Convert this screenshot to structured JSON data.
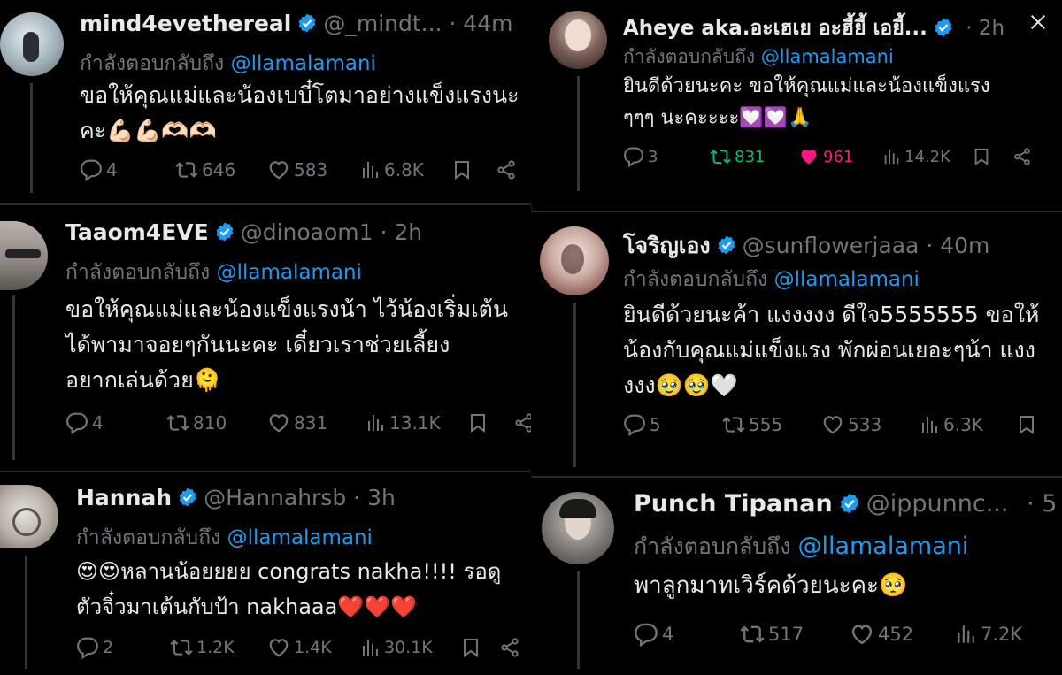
{
  "reply_prefix": "กำลังตอบกลับถึง",
  "colors": {
    "accent": "#1d9bf0",
    "muted": "#71767b",
    "text": "#e7e9ea",
    "like_active": "#f91880",
    "repost_active": "#00ba7c"
  },
  "tweets": [
    {
      "name": "mind4evethereal",
      "handle": "@_mindt...",
      "sep": "·",
      "time": "44m",
      "mention": "@llamalamani",
      "lines": [
        "ขอให้คุณแม่และน้องเบบี๋โตมาอย่างแข็งแรงนะ",
        "คะ💪🏻💪🏻🫶🏻🫶🏻"
      ],
      "replies": "4",
      "reposts": "646",
      "likes": "583",
      "views": "6.8K"
    },
    {
      "name": "Aheye aka.อะเฮเย อะฮี้ยี้ เอยี้...",
      "handle": "",
      "sep": "·",
      "time": "2h",
      "mention": "@llamalamani",
      "lines": [
        "ยินดีด้วยนะคะ ขอให้คุณแม่และน้องแข็งแรง",
        "ๆๆๆ นะคะะะะ💟💟🙏"
      ],
      "replies": "3",
      "reposts": "831",
      "likes": "961",
      "views": "14.2K"
    },
    {
      "name": "Taaom4EVE",
      "handle": "@dinoaom1",
      "sep": "·",
      "time": "2h",
      "mention": "@llamalamani",
      "lines": [
        "ขอให้คุณแม่และน้องแข็งแรงน้า ไว้น้องเริ่มเต้น",
        "ได้พามาจอยๆกันนะคะ เดี๋ยวเราช่วยเลี้ยง",
        "อยากเล่นด้วย🫠"
      ],
      "replies": "4",
      "reposts": "810",
      "likes": "831",
      "views": "13.1K"
    },
    {
      "name": "โจริญเอง",
      "handle": "@sunflowerjaaa",
      "sep": "·",
      "time": "40m",
      "mention": "@llamalamani",
      "lines": [
        "ยินดีด้วยนะค้า แงงงงง ดีใจ5555555 ขอให้",
        "น้องกับคุณแม่แข็งแรง พักผ่อนเยอะๆน้า แงง",
        "งงง🥹🥹🤍"
      ],
      "replies": "5",
      "reposts": "555",
      "likes": "533",
      "views": "6.3K"
    },
    {
      "name": "Hannah",
      "handle": "@Hannahrsb",
      "sep": "·",
      "time": "3h",
      "mention": "@llamalamani",
      "lines": [
        "😍😍หลานน้อยยยย congrats nakha!!!! รอดู",
        "ตัวจิ๋วมาเต้นกับป้า nakhaaa❤️❤️❤️"
      ],
      "replies": "2",
      "reposts": "1.2K",
      "likes": "1.4K",
      "views": "30.1K"
    },
    {
      "name": "Punch Tipanan",
      "handle": "@ippunnc...",
      "sep": "·",
      "time": "5",
      "mention": "@llamalamani",
      "lines": [
        "พาลูกมาทเวิร์คด้วยนะคะ🥺"
      ],
      "replies": "4",
      "reposts": "517",
      "likes": "452",
      "views": "7.2K"
    }
  ]
}
